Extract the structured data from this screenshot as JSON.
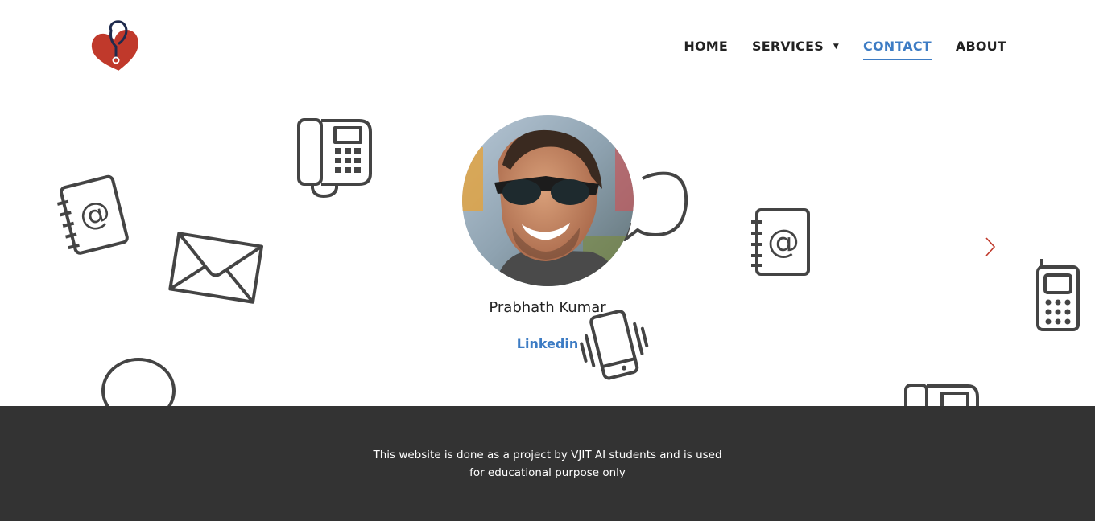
{
  "logo": {
    "icon": "heart-stethoscope-icon",
    "color": "#c0392b"
  },
  "nav": {
    "home": "HOME",
    "services": "SERVICES",
    "contact": "CONTACT",
    "about": "ABOUT",
    "active": "contact",
    "accent_color": "#3d7cc4"
  },
  "background_icons": [
    "address-book-icon",
    "desk-phone-icon",
    "envelope-icon",
    "speech-bubble-icon",
    "address-book-icon",
    "mobile-phone-icon",
    "vibrating-smartphone-icon",
    "speech-bubble-icon",
    "desk-phone-icon"
  ],
  "profile": {
    "name": "Prabhath Kumar",
    "link_label": "Linkedin",
    "photo": "profile-photo"
  },
  "carousel": {
    "next_icon": "chevron-right-icon",
    "arrow_color": "#c0392b"
  },
  "footer": {
    "line1": "This website is done as a project by VJIT AI students and is used",
    "line2": "for educational purpose only",
    "background": "#333333"
  }
}
